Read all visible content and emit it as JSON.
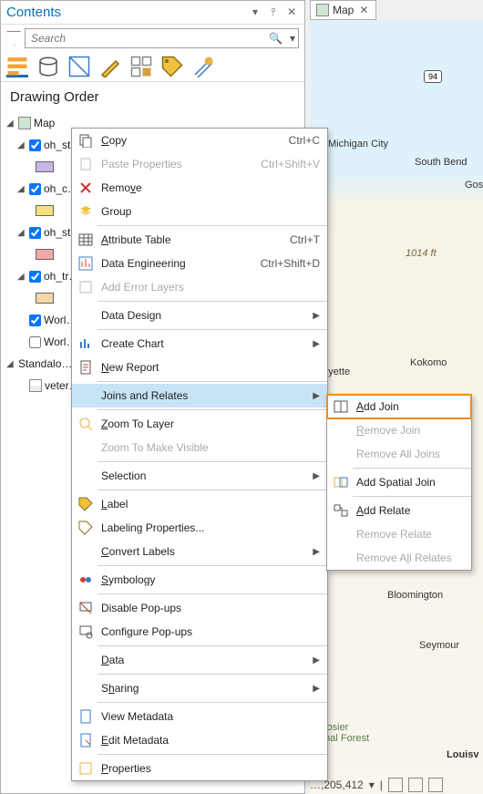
{
  "pane": {
    "title": "Contents"
  },
  "search": {
    "placeholder": "Search"
  },
  "drawing_order": "Drawing Order",
  "tree": {
    "map": "Map",
    "l0": "oh_st…",
    "s0": "#c7b7e8",
    "l1": "oh_c…",
    "s1": "#f7e07a",
    "l2": "oh_st…",
    "s2": "#f3a7a7",
    "l3": "oh_tr…",
    "s3": "#f5d7a7",
    "l4": "Worl…",
    "l5": "Worl…",
    "standalone": "Standalo…",
    "t0": "veter…"
  },
  "maptab": {
    "label": "Map"
  },
  "cities": {
    "michigan_city": "Michigan City",
    "south_bend": "South Bend",
    "gos": "Gos",
    "lafayette": "afayette",
    "kokomo": "Kokomo",
    "bloomington": "Bloomington",
    "seymour": "Seymour",
    "hoosier": "loosier\nonal Forest",
    "louisv": "Louisv"
  },
  "elev": "1014 ft",
  "road94": "94",
  "menu": {
    "copy": "Copy",
    "copy_hk": "Ctrl+C",
    "paste_props": "Paste Properties",
    "paste_hk": "Ctrl+Shift+V",
    "remove": "Remove",
    "group": "Group",
    "attr_table": "Attribute Table",
    "attr_hk": "Ctrl+T",
    "data_eng": "Data Engineering",
    "data_eng_hk": "Ctrl+Shift+D",
    "add_err": "Add Error Layers",
    "data_design": "Data Design",
    "create_chart": "Create Chart",
    "new_report": "New Report",
    "joins": "Joins and Relates",
    "zoom_layer": "Zoom To Layer",
    "zoom_vis": "Zoom To Make Visible",
    "selection": "Selection",
    "label": "Label",
    "label_props": "Labeling Properties...",
    "convert_labels": "Convert Labels",
    "symbology": "Symbology",
    "disable_popups": "Disable Pop-ups",
    "configure_popups": "Configure Pop-ups",
    "data": "Data",
    "sharing": "Sharing",
    "view_meta": "View Metadata",
    "edit_meta": "Edit Metadata",
    "properties": "Properties"
  },
  "submenu": {
    "add_join": "Add Join",
    "remove_join": "Remove Join",
    "remove_all_joins": "Remove All Joins",
    "add_spatial": "Add Spatial Join",
    "add_relate": "Add Relate",
    "remove_relate": "Remove Relate",
    "remove_all_relates": "Remove All Relates"
  },
  "status": {
    "scale": "…,205,412"
  }
}
